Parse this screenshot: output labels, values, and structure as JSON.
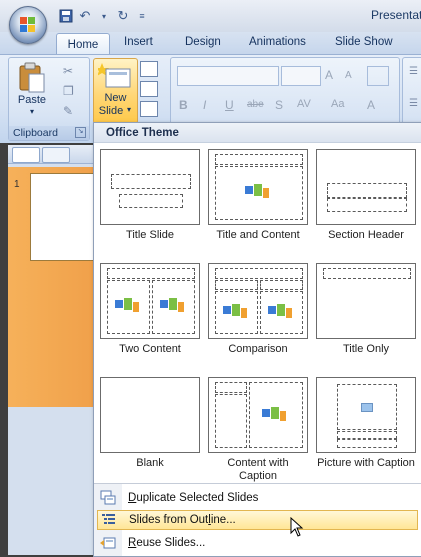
{
  "app": {
    "title": "Presentat"
  },
  "tabs": [
    "Home",
    "Insert",
    "Design",
    "Animations",
    "Slide Show"
  ],
  "ribbon": {
    "clipboard_group": "Clipboard",
    "paste_label": "Paste",
    "new_slide_label_1": "New",
    "new_slide_label_2": "Slide"
  },
  "slide_pane": {
    "slide_number": "1"
  },
  "gallery": {
    "header": "Office Theme",
    "layouts": [
      {
        "name": "Title Slide"
      },
      {
        "name": "Title and Content"
      },
      {
        "name": "Section Header"
      },
      {
        "name": "Two Content"
      },
      {
        "name": "Comparison"
      },
      {
        "name": "Title Only"
      },
      {
        "name": "Blank"
      },
      {
        "name": "Content with Caption"
      },
      {
        "name": "Picture with Caption"
      }
    ],
    "menu": [
      {
        "accel": "D",
        "rest": "uplicate Selected Slides",
        "hover": false
      },
      {
        "accel": "",
        "pre": "Slides from Out",
        "accel2": "l",
        "rest": "ine...",
        "hover": true
      },
      {
        "accel": "R",
        "rest": "euse Slides...",
        "hover": false
      }
    ]
  },
  "colors": {
    "highlight": "#ffe696",
    "accent": "#15325e",
    "thumb_selected": "#f6b15a"
  }
}
